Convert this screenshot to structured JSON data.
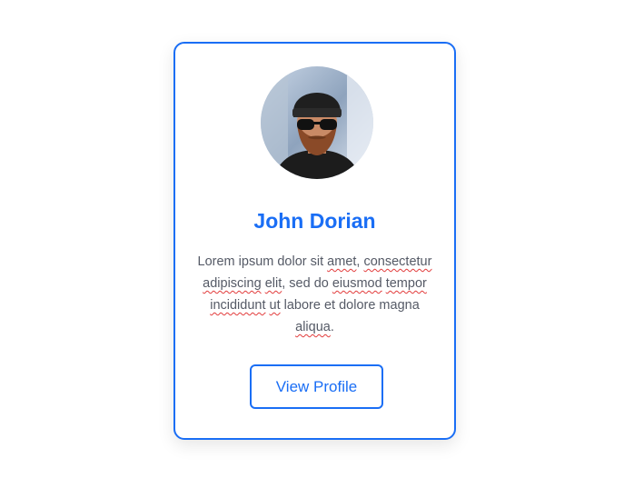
{
  "profile_card": {
    "avatar_icon": "user-photo",
    "name": "John Dorian",
    "bio": {
      "w1": "Lorem ipsum dolor sit ",
      "w2": "amet",
      "w3": ", ",
      "w4": "consectetur",
      "w5": " ",
      "w6": "adipiscing",
      "w7": " ",
      "w8": "elit",
      "w9": ", sed do ",
      "w10": "eiusmod",
      "w11": " ",
      "w12": "tempor",
      "w13": " ",
      "w14": "incididunt",
      "w15": " ",
      "w16": "ut",
      "w17": " labore et dolore magna ",
      "w18": "aliqua",
      "w19": "."
    },
    "button_label": "View Profile"
  },
  "colors": {
    "accent": "#1a6ef5",
    "text": "#555a66",
    "spellcheck": "#e23b3b"
  }
}
